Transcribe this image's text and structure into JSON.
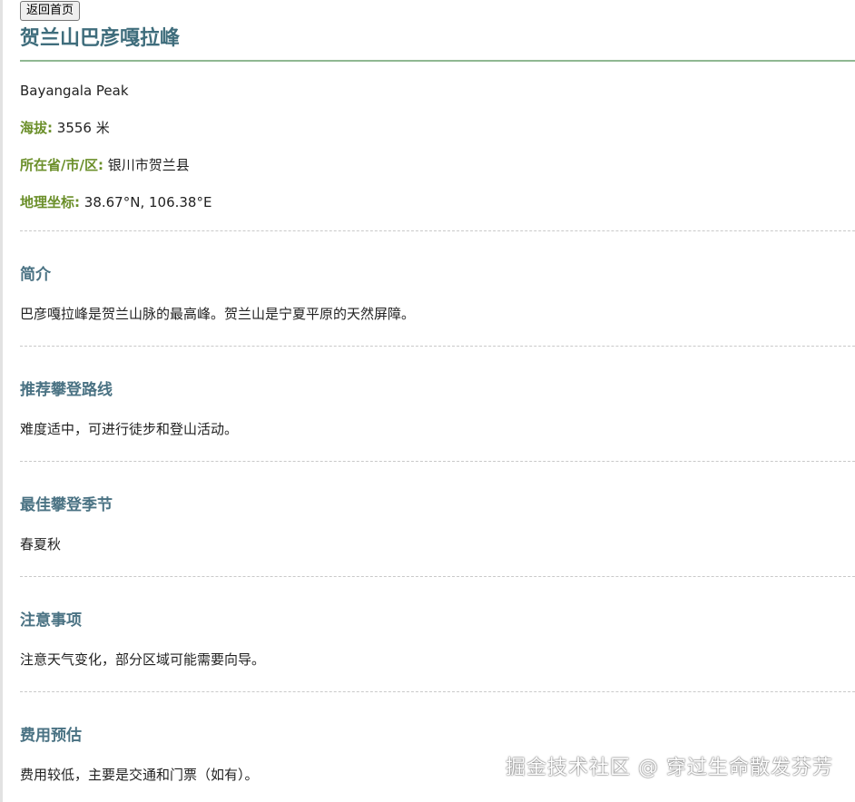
{
  "nav": {
    "back_label": "返回首页"
  },
  "header": {
    "title": "贺兰山巴彦嘎拉峰"
  },
  "info": {
    "english_name": "Bayangala Peak",
    "altitude_label": "海拔:",
    "altitude_value": "3556 米",
    "location_label": "所在省/市/区:",
    "location_value": "银川市贺兰县",
    "coords_label": "地理坐标:",
    "coords_value": "38.67°N, 106.38°E"
  },
  "sections": [
    {
      "heading": "简介",
      "text": "巴彦嘎拉峰是贺兰山脉的最高峰。贺兰山是宁夏平原的天然屏障。"
    },
    {
      "heading": "推荐攀登路线",
      "text": "难度适中，可进行徒步和登山活动。"
    },
    {
      "heading": "最佳攀登季节",
      "text": "春夏秋"
    },
    {
      "heading": "注意事项",
      "text": "注意天气变化，部分区域可能需要向导。"
    },
    {
      "heading": "费用预估",
      "text": "费用较低，主要是交通和门票（如有）。"
    }
  ],
  "watermark": "掘金技术社区 @ 穿过生命散发芬芳",
  "colors": {
    "title": "#3f6d7c",
    "label": "#6b8f2a",
    "section_heading": "#4a7283",
    "title_rule": "#8fb892"
  }
}
